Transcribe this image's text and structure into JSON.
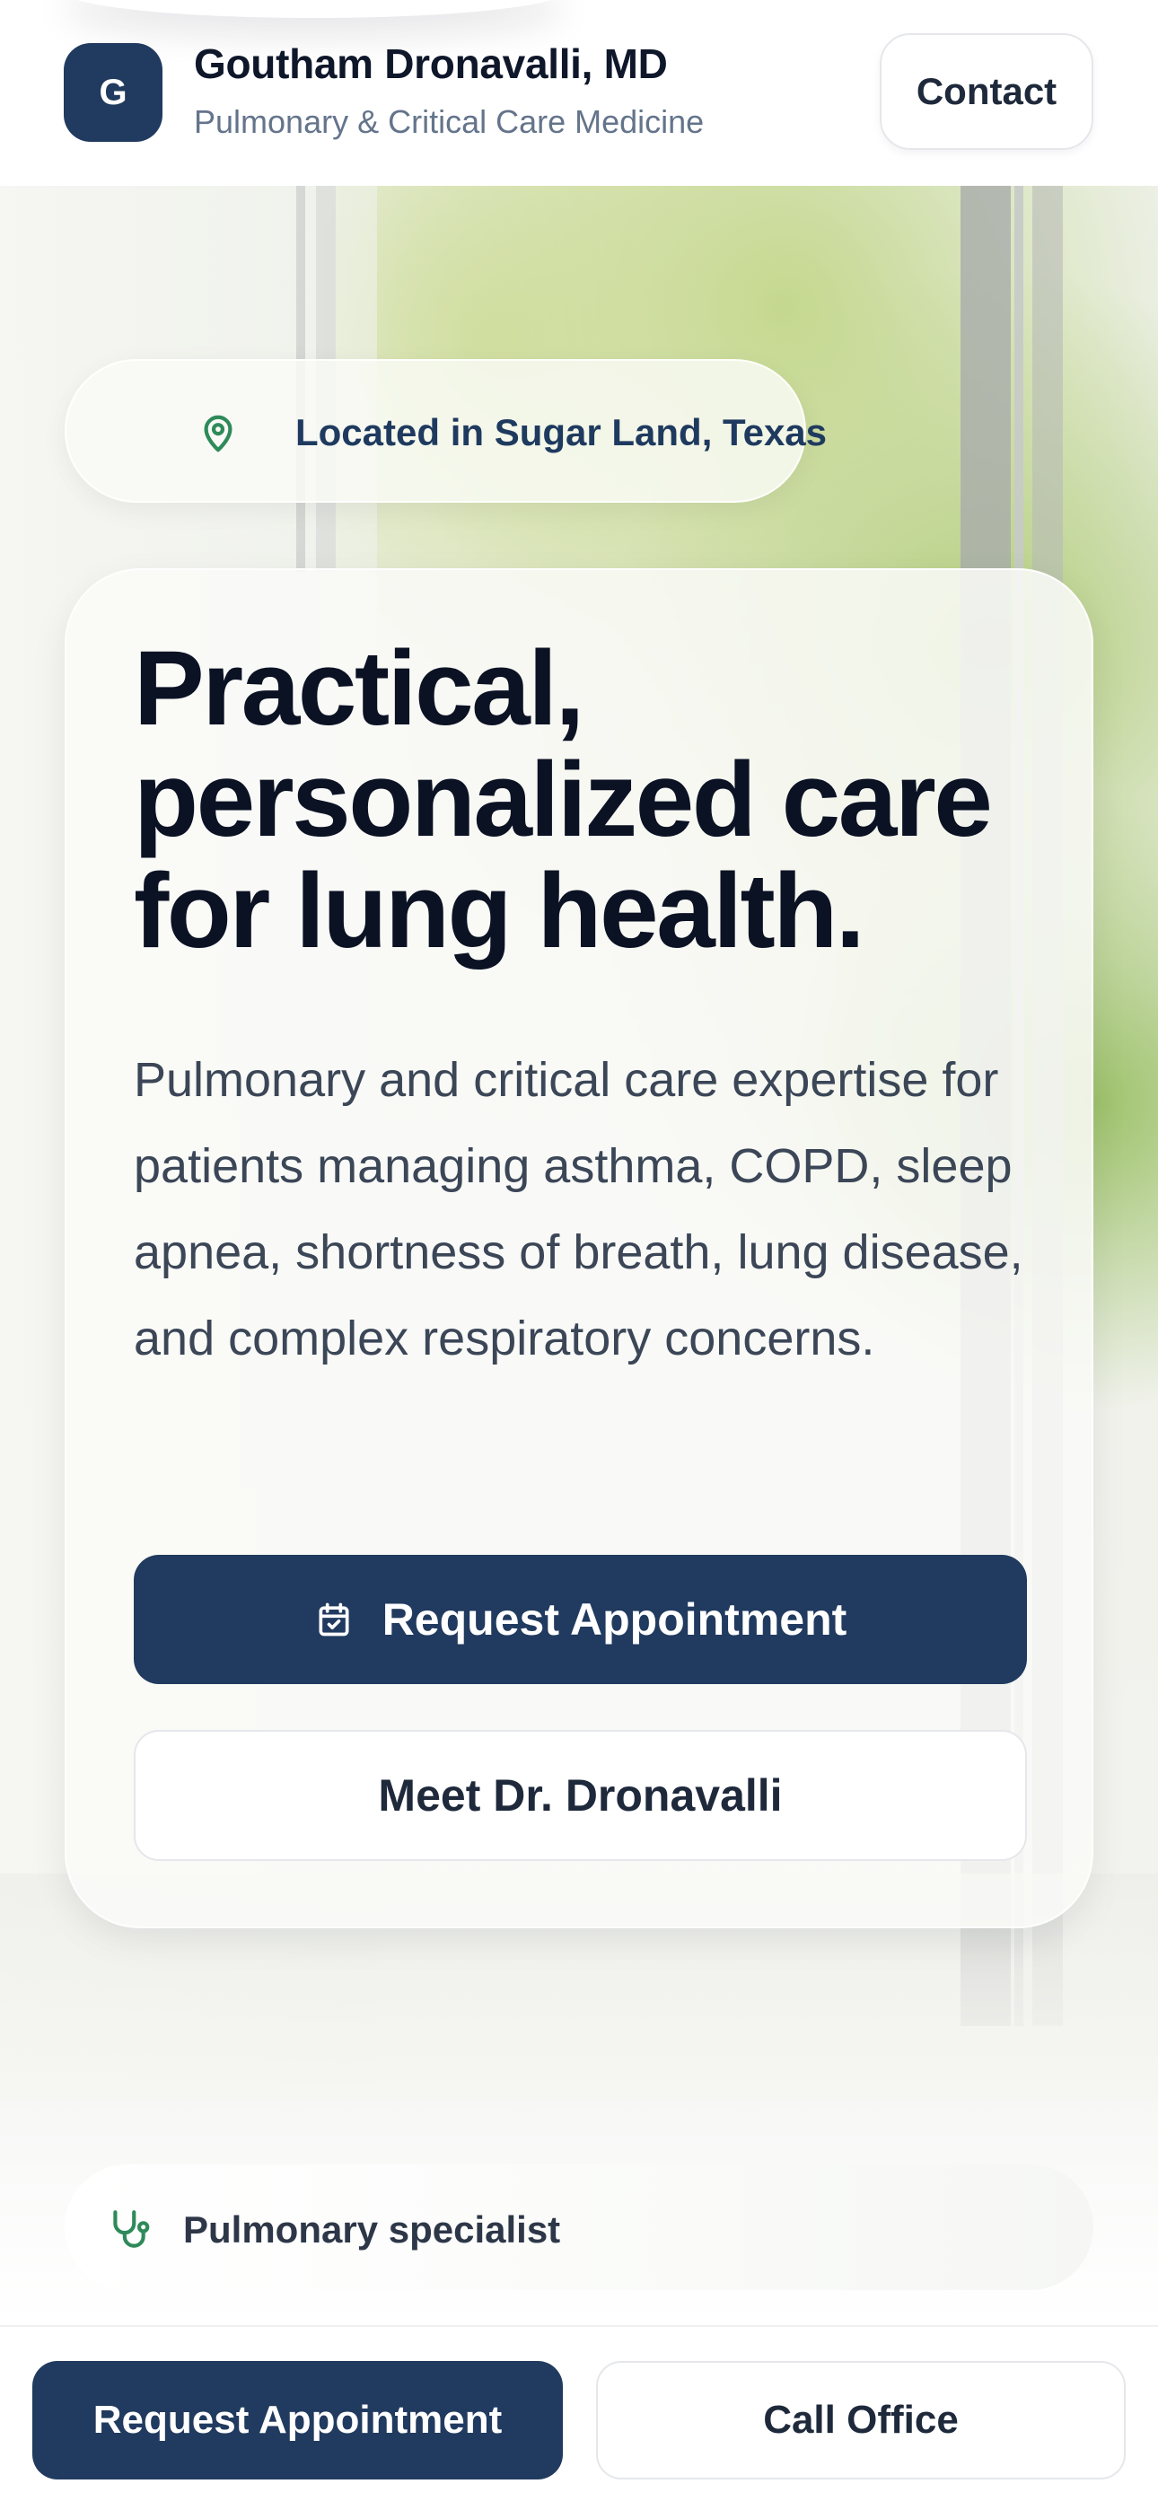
{
  "header": {
    "avatar_initial": "G",
    "doctor_name": "Goutham Dronavalli, MD",
    "specialty": "Pulmonary & Critical Care Medicine",
    "contact_label": "Contact"
  },
  "hero": {
    "location_text": "Located in Sugar Land, Texas",
    "title": "Practical, personalized care for lung health.",
    "description": "Pulmonary and critical care expertise for patients managing asthma, COPD, sleep apnea, shortness of breath, lung disease, and complex respiratory concerns.",
    "primary_cta": "Request Appointment",
    "secondary_cta": "Meet Dr. Dronavalli"
  },
  "highlight": {
    "label": "Pulmonary specialist"
  },
  "bottom_bar": {
    "primary_label": "Request Appointment",
    "secondary_label": "Call Office"
  },
  "colors": {
    "brand_navy": "#213a5f",
    "accent_green": "#2f8a5a",
    "text_dark": "#0b1224",
    "text_muted": "#64748b"
  },
  "icons": {
    "location": "map-pin-icon",
    "calendar": "calendar-check-icon",
    "specialist": "stethoscope-icon"
  }
}
